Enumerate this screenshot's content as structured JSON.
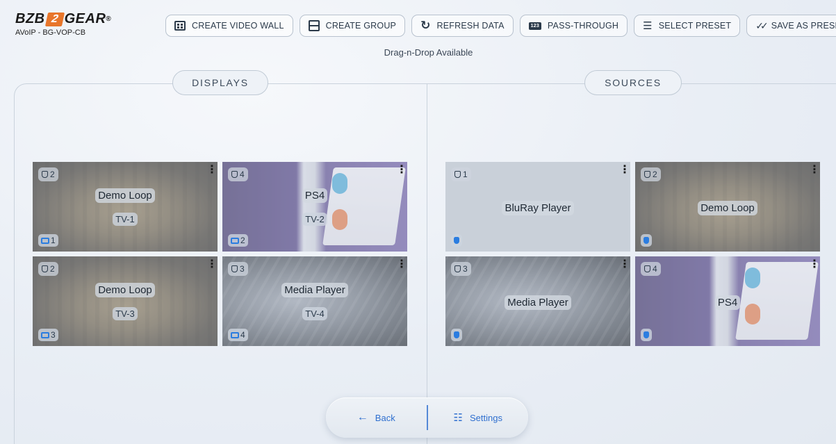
{
  "brand": {
    "name_part1": "BZB",
    "name_part2": "2",
    "name_part3": "GEAR",
    "reg": "®",
    "model": "AVoIP - BG-VOP-CB"
  },
  "toolbar": [
    {
      "label": "CREATE VIDEO WALL",
      "icon": "video-wall-icon"
    },
    {
      "label": "CREATE GROUP",
      "icon": "group-icon"
    },
    {
      "label": "REFRESH DATA",
      "icon": "refresh-icon"
    },
    {
      "label": "PASS-THROUGH",
      "icon": "pass-through-icon",
      "icon_text": "123"
    },
    {
      "label": "SELECT PRESET",
      "icon": "list-icon"
    },
    {
      "label": "SAVE AS PRESET",
      "icon": "double-check-icon"
    }
  ],
  "hint": "Drag-n-Drop Available",
  "sections": {
    "displays": "DISPLAYS",
    "sources": "SOURCES"
  },
  "displays": [
    {
      "port": "2",
      "source": "Demo Loop",
      "tv": "TV-1",
      "num": "1",
      "art": "dungeon"
    },
    {
      "port": "4",
      "source": "PS4",
      "tv": "TV-2",
      "num": "2",
      "art": "ps4"
    },
    {
      "port": "2",
      "source": "Demo Loop",
      "tv": "TV-3",
      "num": "3",
      "art": "dungeon"
    },
    {
      "port": "3",
      "source": "Media Player",
      "tv": "TV-4",
      "num": "4",
      "art": "media"
    }
  ],
  "sources": [
    {
      "port": "1",
      "name": "BluRay Player",
      "art": "plain"
    },
    {
      "port": "2",
      "name": "Demo Loop",
      "art": "dungeon"
    },
    {
      "port": "3",
      "name": "Media Player",
      "art": "media"
    },
    {
      "port": "4",
      "name": "PS4",
      "art": "ps4"
    }
  ],
  "nav": {
    "back": "Back",
    "settings": "Settings"
  },
  "colors": {
    "accent": "#2f6fcf",
    "brand_orange": "#e8762b"
  }
}
